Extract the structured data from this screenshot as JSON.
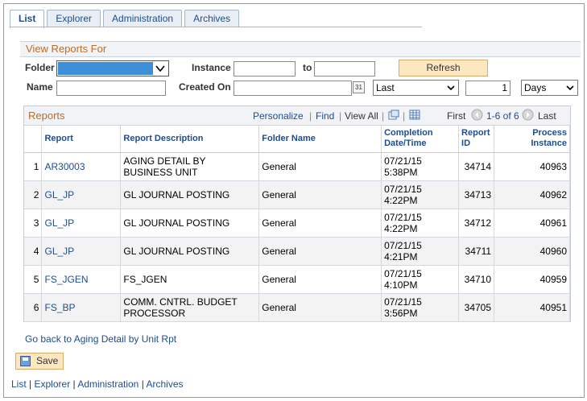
{
  "tabs": [
    "List",
    "Explorer",
    "Administration",
    "Archives"
  ],
  "view_reports_for": "View Reports For",
  "form": {
    "folder_label": "Folder",
    "instance_label": "Instance",
    "to_label": "to",
    "refresh_label": "Refresh",
    "name_label": "Name",
    "created_on_label": "Created On",
    "last_select": "Last",
    "count_value": "1",
    "unit_select": "Days"
  },
  "grid": {
    "title": "Reports",
    "personalize": "Personalize",
    "find": "Find",
    "view_all": "View All",
    "first": "First",
    "range": "1-6 of 6",
    "last": "Last",
    "headers": [
      "Report",
      "Report Description",
      "Folder Name",
      "Completion Date/Time",
      "Report ID",
      "Process Instance"
    ],
    "rows": [
      {
        "n": "1",
        "report": "AR30003",
        "desc": "AGING DETAIL BY BUSINESS UNIT",
        "folder": "General",
        "date": "07/21/15",
        "time": "5:38PM",
        "id": "34714",
        "instance": "40963"
      },
      {
        "n": "2",
        "report": "GL_JP",
        "desc": "GL JOURNAL POSTING",
        "folder": "General",
        "date": "07/21/15",
        "time": "4:22PM",
        "id": "34713",
        "instance": "40962"
      },
      {
        "n": "3",
        "report": "GL_JP",
        "desc": "GL JOURNAL POSTING",
        "folder": "General",
        "date": "07/21/15",
        "time": "4:22PM",
        "id": "34712",
        "instance": "40961"
      },
      {
        "n": "4",
        "report": "GL_JP",
        "desc": "GL JOURNAL POSTING",
        "folder": "General",
        "date": "07/21/15",
        "time": "4:21PM",
        "id": "34711",
        "instance": "40960"
      },
      {
        "n": "5",
        "report": "FS_JGEN",
        "desc": "FS_JGEN",
        "folder": "General",
        "date": "07/21/15",
        "time": "4:10PM",
        "id": "34710",
        "instance": "40959"
      },
      {
        "n": "6",
        "report": "FS_BP",
        "desc": "COMM. CNTRL. BUDGET PROCESSOR",
        "folder": "General",
        "date": "07/21/15",
        "time": "3:56PM",
        "id": "34705",
        "instance": "40951"
      }
    ]
  },
  "go_back": "Go back to Aging Detail by Unit Rpt",
  "save_label": "Save",
  "footer_links": [
    "List",
    "Explorer",
    "Administration",
    "Archives"
  ]
}
